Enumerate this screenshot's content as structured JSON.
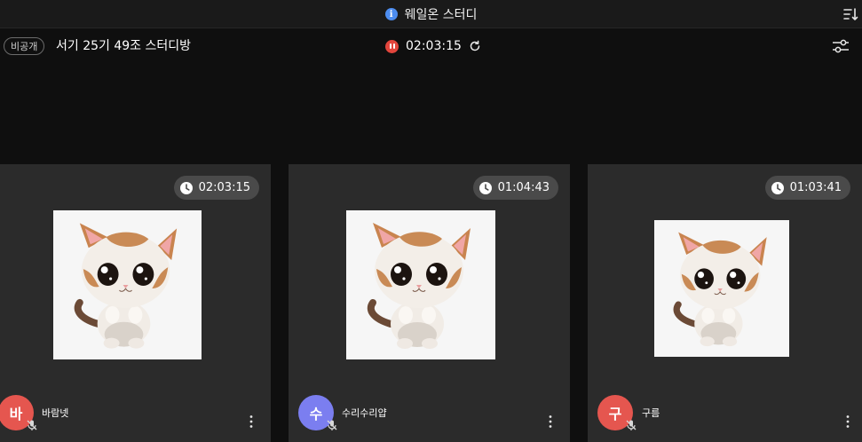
{
  "app": {
    "title": "웨일온 스터디"
  },
  "room": {
    "visibility_badge": "비공개",
    "name": "서기 25기 49조 스터디방",
    "timer": "02:03:15"
  },
  "icons": {
    "info": "info-icon",
    "sort": "sort-icon",
    "pause": "pause-icon",
    "refresh": "refresh-icon",
    "settings": "sliders-icon",
    "clock": "clock-icon",
    "mic_off": "mic-off-icon",
    "more": "more-vertical-icon"
  },
  "colors": {
    "info_blue": "#4d8df0",
    "pause_red": "#e2453c",
    "tile_bg": "#2b2b2b"
  },
  "participants": [
    {
      "time": "02:03:15",
      "initial": "바",
      "name": "바람넷",
      "avatar_color": "#e5564f"
    },
    {
      "time": "01:04:43",
      "initial": "수",
      "name": "수리수리얍",
      "avatar_color": "#7b7ef0"
    },
    {
      "time": "01:03:41",
      "initial": "구",
      "name": "구름",
      "avatar_color": "#e5564f"
    }
  ]
}
